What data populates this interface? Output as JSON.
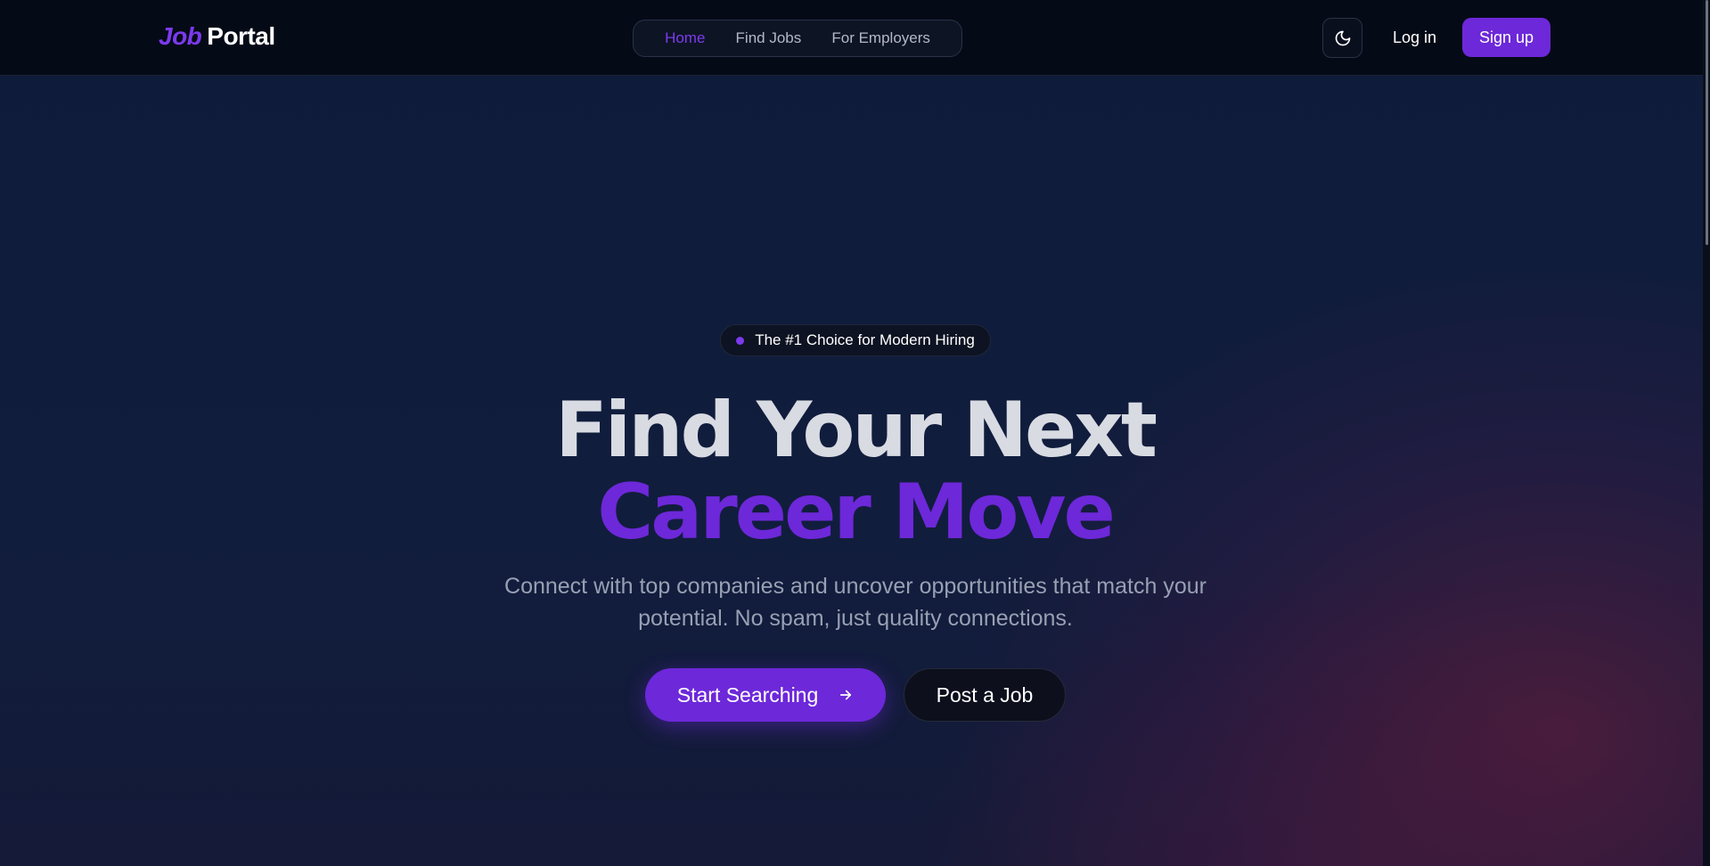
{
  "navbar": {
    "logo_job": "Job",
    "logo_portal": "Portal",
    "links": [
      {
        "label": "Home",
        "active": true
      },
      {
        "label": "Find Jobs",
        "active": false
      },
      {
        "label": "For Employers",
        "active": false
      }
    ],
    "theme_icon": "moon-icon",
    "login_label": "Log in",
    "signup_label": "Sign up"
  },
  "hero": {
    "badge_text": "The #1 Choice for Modern Hiring",
    "headline_line1": "Find Your Next",
    "headline_line2": "Career Move",
    "subtitle": "Connect with top companies and uncover opportunities that match your potential. No spam, just quality connections.",
    "primary_button": "Start Searching",
    "primary_button_icon": "arrow-right-icon",
    "secondary_button": "Post a Job"
  },
  "colors": {
    "accent": "#6d28d9",
    "nav_background": "#050a17",
    "hero_background": "#0f1b3a"
  }
}
